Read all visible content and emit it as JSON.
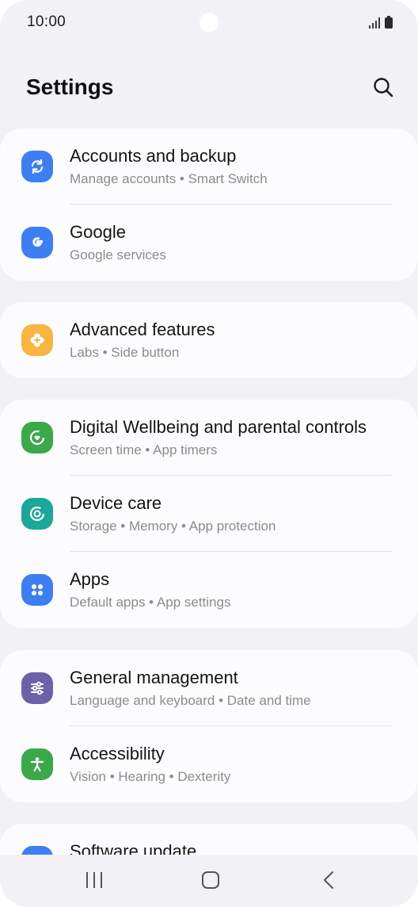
{
  "status_bar": {
    "time": "10:00",
    "icons": [
      "signal-icon",
      "battery-icon"
    ]
  },
  "header": {
    "title": "Settings",
    "search_icon": "search-icon"
  },
  "groups": [
    {
      "items": [
        {
          "title": "Accounts and backup",
          "subtitle": "Manage accounts  •  Smart Switch",
          "icon": "sync-icon",
          "color": "#3d7ff0"
        },
        {
          "title": "Google",
          "subtitle": "Google services",
          "icon": "google-icon",
          "color": "#3d7ff0"
        }
      ]
    },
    {
      "items": [
        {
          "title": "Advanced features",
          "subtitle": "Labs  •  Side button",
          "icon": "plus-badge-icon",
          "color": "#f9b540"
        }
      ]
    },
    {
      "items": [
        {
          "title": "Digital Wellbeing and parental controls",
          "subtitle": "Screen time  •  App timers",
          "icon": "wellbeing-icon",
          "color": "#3ba849"
        },
        {
          "title": "Device care",
          "subtitle": "Storage  •  Memory  •  App protection",
          "icon": "device-care-icon",
          "color": "#1da69a"
        },
        {
          "title": "Apps",
          "subtitle": "Default apps  •  App settings",
          "icon": "apps-grid-icon",
          "color": "#3d7ff0"
        }
      ]
    },
    {
      "items": [
        {
          "title": "General management",
          "subtitle": "Language and keyboard  •  Date and time",
          "icon": "sliders-icon",
          "color": "#6b63a8"
        },
        {
          "title": "Accessibility",
          "subtitle": "Vision  •  Hearing  •  Dexterity",
          "icon": "accessibility-icon",
          "color": "#3ba849"
        }
      ]
    },
    {
      "items": [
        {
          "title": "Software update",
          "subtitle": "",
          "icon": "software-update-icon",
          "color": "#3d7ff0"
        }
      ]
    }
  ],
  "nav_bar": {
    "icons": [
      "recents-icon",
      "home-icon",
      "back-icon"
    ]
  }
}
